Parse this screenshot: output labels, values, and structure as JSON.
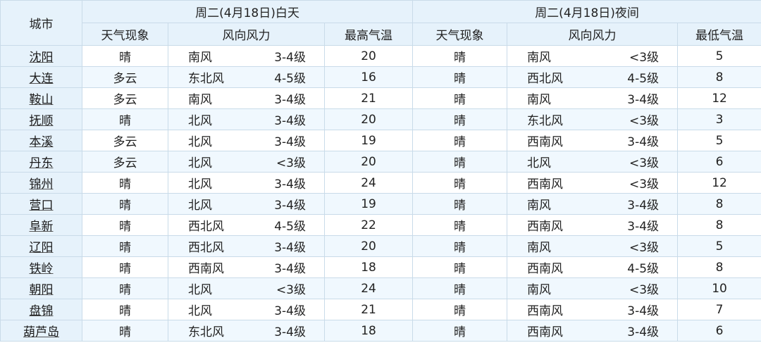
{
  "header": {
    "city_col": "城市",
    "day_group": "周二(4月18日)白天",
    "night_group": "周二(4月18日)夜间",
    "cols": {
      "day_weather": "天气现象",
      "day_wind": "风向风力",
      "high_temp": "最高气温",
      "night_weather": "天气现象",
      "night_wind": "风向风力",
      "low_temp": "最低气温"
    }
  },
  "rows": [
    {
      "city": "沈阳",
      "day_weather": "晴",
      "day_dir": "南风",
      "day_force": "3-4级",
      "high": "20",
      "night_weather": "晴",
      "night_dir": "南风",
      "night_force": "<3级",
      "low": "5"
    },
    {
      "city": "大连",
      "day_weather": "多云",
      "day_dir": "东北风",
      "day_force": "4-5级",
      "high": "16",
      "night_weather": "晴",
      "night_dir": "西北风",
      "night_force": "4-5级",
      "low": "8"
    },
    {
      "city": "鞍山",
      "day_weather": "多云",
      "day_dir": "南风",
      "day_force": "3-4级",
      "high": "21",
      "night_weather": "晴",
      "night_dir": "南风",
      "night_force": "3-4级",
      "low": "12"
    },
    {
      "city": "抚顺",
      "day_weather": "晴",
      "day_dir": "北风",
      "day_force": "3-4级",
      "high": "20",
      "night_weather": "晴",
      "night_dir": "东北风",
      "night_force": "<3级",
      "low": "3"
    },
    {
      "city": "本溪",
      "day_weather": "多云",
      "day_dir": "北风",
      "day_force": "3-4级",
      "high": "19",
      "night_weather": "晴",
      "night_dir": "西南风",
      "night_force": "3-4级",
      "low": "5"
    },
    {
      "city": "丹东",
      "day_weather": "多云",
      "day_dir": "北风",
      "day_force": "<3级",
      "high": "20",
      "night_weather": "晴",
      "night_dir": "北风",
      "night_force": "<3级",
      "low": "6"
    },
    {
      "city": "锦州",
      "day_weather": "晴",
      "day_dir": "北风",
      "day_force": "3-4级",
      "high": "24",
      "night_weather": "晴",
      "night_dir": "西南风",
      "night_force": "<3级",
      "low": "12"
    },
    {
      "city": "营口",
      "day_weather": "晴",
      "day_dir": "北风",
      "day_force": "3-4级",
      "high": "19",
      "night_weather": "晴",
      "night_dir": "南风",
      "night_force": "3-4级",
      "low": "8"
    },
    {
      "city": "阜新",
      "day_weather": "晴",
      "day_dir": "西北风",
      "day_force": "4-5级",
      "high": "22",
      "night_weather": "晴",
      "night_dir": "西南风",
      "night_force": "3-4级",
      "low": "8"
    },
    {
      "city": "辽阳",
      "day_weather": "晴",
      "day_dir": "西北风",
      "day_force": "3-4级",
      "high": "20",
      "night_weather": "晴",
      "night_dir": "南风",
      "night_force": "<3级",
      "low": "5"
    },
    {
      "city": "铁岭",
      "day_weather": "晴",
      "day_dir": "西南风",
      "day_force": "3-4级",
      "high": "18",
      "night_weather": "晴",
      "night_dir": "西南风",
      "night_force": "4-5级",
      "low": "8"
    },
    {
      "city": "朝阳",
      "day_weather": "晴",
      "day_dir": "北风",
      "day_force": "<3级",
      "high": "24",
      "night_weather": "晴",
      "night_dir": "南风",
      "night_force": "<3级",
      "low": "10"
    },
    {
      "city": "盘锦",
      "day_weather": "晴",
      "day_dir": "北风",
      "day_force": "3-4级",
      "high": "21",
      "night_weather": "晴",
      "night_dir": "西南风",
      "night_force": "3-4级",
      "low": "7"
    },
    {
      "city": "葫芦岛",
      "day_weather": "晴",
      "day_dir": "东北风",
      "day_force": "3-4级",
      "high": "18",
      "night_weather": "晴",
      "night_dir": "西南风",
      "night_force": "3-4级",
      "low": "6"
    }
  ]
}
